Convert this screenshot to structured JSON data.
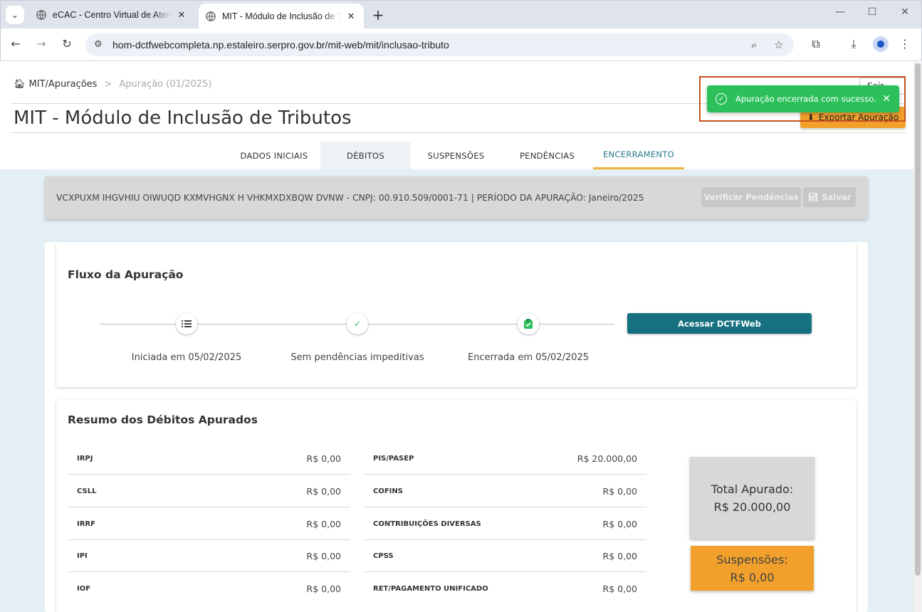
{
  "browser": {
    "tabs": [
      {
        "title": "eCAC - Centro Virtual de Atendimento",
        "active": false
      },
      {
        "title": "MIT - Módulo de Inclusão de Tributos",
        "active": true
      }
    ],
    "url": "hom-dctfwebcompleta.np.estaleiro.serpro.gov.br/mit-web/mit/inclusao-tributo"
  },
  "header": {
    "breadcrumb": {
      "home": "MIT/Apurações",
      "separator": ">",
      "current": "Apuração (01/2025)"
    },
    "title": "MIT - Módulo de Inclusão de Tributos",
    "sair_label": "Sair",
    "export_label": "Exportar Apuração"
  },
  "toast": {
    "message": "Apuração encerrada com sucesso.",
    "color": "#2cc05b"
  },
  "tabs": [
    {
      "label": "DADOS INICIAIS"
    },
    {
      "label": "DÉBITOS"
    },
    {
      "label": "SUSPENSÕES"
    },
    {
      "label": "PENDÊNCIAS"
    },
    {
      "label": "ENCERRAMENTO",
      "active": true
    }
  ],
  "infobar": {
    "text": "VCXPUXM IHGVHIU OIWUQD KXMVHGNX H VHKMXDXBQW DVNW - CNPJ: 00.910.509/0001-71  |  PERÍODO DA APURAÇÃO: Janeiro/2025",
    "verify_label": "Verificar Pendências",
    "save_label": "Salvar"
  },
  "flow": {
    "title": "Fluxo da Apuração",
    "steps": [
      {
        "label": "Iniciada em 05/02/2025",
        "icon": "list-icon"
      },
      {
        "label": "Sem pendências impeditivas",
        "icon": "check-icon"
      },
      {
        "label": "Encerrada em 05/02/2025",
        "icon": "clipboard-check-icon"
      }
    ],
    "access_label": "Acessar DCTFWeb"
  },
  "summary": {
    "title": "Resumo dos Débitos Apurados",
    "left": [
      {
        "label": "IRPJ",
        "value": "R$ 0,00"
      },
      {
        "label": "CSLL",
        "value": "R$ 0,00"
      },
      {
        "label": "IRRF",
        "value": "R$ 0,00"
      },
      {
        "label": "IPI",
        "value": "R$ 0,00"
      },
      {
        "label": "IOF",
        "value": "R$ 0,00"
      }
    ],
    "right": [
      {
        "label": "PIS/PASEP",
        "value": "R$ 20.000,00"
      },
      {
        "label": "COFINS",
        "value": "R$ 0,00"
      },
      {
        "label": "CONTRIBUIÇÕES DIVERSAS",
        "value": "R$ 0,00"
      },
      {
        "label": "CPSS",
        "value": "R$ 0,00"
      },
      {
        "label": "RET/PAGAMENTO UNIFICADO",
        "value": "R$ 0,00"
      }
    ],
    "total_label": "Total Apurado:",
    "total_value": "R$ 20.000,00",
    "susp_label": "Suspensões:",
    "susp_value": "R$ 0,00"
  }
}
